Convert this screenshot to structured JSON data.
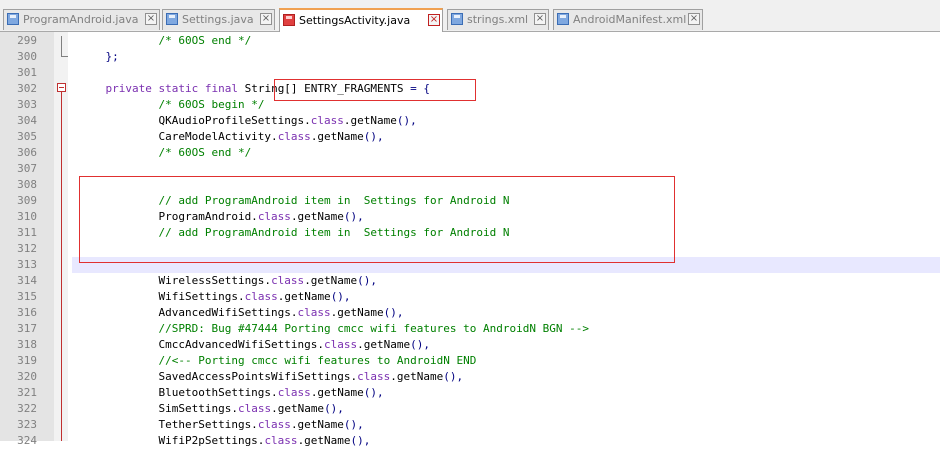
{
  "tabs": [
    {
      "label": "ProgramAndroid.java",
      "active": false
    },
    {
      "label": "Settings.java",
      "active": false
    },
    {
      "label": "SettingsActivity.java",
      "active": true
    },
    {
      "label": "strings.xml",
      "active": false
    },
    {
      "label": "AndroidManifest.xml",
      "active": false
    }
  ],
  "close_glyph": "×",
  "editor": {
    "lines": [
      {
        "n": "299",
        "tokens": [
          {
            "t": "            "
          },
          {
            "t": "/* 60OS end */",
            "c": "cm"
          }
        ]
      },
      {
        "n": "300",
        "tokens": [
          {
            "t": "    "
          },
          {
            "t": "};",
            "c": "op"
          }
        ]
      },
      {
        "n": "301",
        "tokens": []
      },
      {
        "n": "302",
        "tokens": [
          {
            "t": "    "
          },
          {
            "t": "private static final",
            "c": "kw"
          },
          {
            "t": " String[] ENTRY_FRAGMENTS "
          },
          {
            "t": "= {",
            "c": "op"
          }
        ]
      },
      {
        "n": "303",
        "tokens": [
          {
            "t": "            "
          },
          {
            "t": "/* 60OS begin */",
            "c": "cm"
          }
        ]
      },
      {
        "n": "304",
        "tokens": [
          {
            "t": "            QKAudioProfileSettings."
          },
          {
            "t": "class",
            "c": "kw"
          },
          {
            "t": ".getName"
          },
          {
            "t": "(),",
            "c": "op"
          }
        ]
      },
      {
        "n": "305",
        "tokens": [
          {
            "t": "            CareModelActivity."
          },
          {
            "t": "class",
            "c": "kw"
          },
          {
            "t": ".getName"
          },
          {
            "t": "(),",
            "c": "op"
          }
        ]
      },
      {
        "n": "306",
        "tokens": [
          {
            "t": "            "
          },
          {
            "t": "/* 60OS end */",
            "c": "cm"
          }
        ]
      },
      {
        "n": "307",
        "tokens": []
      },
      {
        "n": "308",
        "tokens": []
      },
      {
        "n": "309",
        "tokens": [
          {
            "t": "            "
          },
          {
            "t": "// add ProgramAndroid item in  Settings for Android N",
            "c": "cm"
          }
        ]
      },
      {
        "n": "310",
        "tokens": [
          {
            "t": "            ProgramAndroid."
          },
          {
            "t": "class",
            "c": "kw"
          },
          {
            "t": ".getName"
          },
          {
            "t": "(),",
            "c": "op"
          }
        ]
      },
      {
        "n": "311",
        "tokens": [
          {
            "t": "            "
          },
          {
            "t": "// add ProgramAndroid item in  Settings for Android N",
            "c": "cm"
          }
        ]
      },
      {
        "n": "312",
        "tokens": []
      },
      {
        "n": "313",
        "tokens": []
      },
      {
        "n": "314",
        "tokens": [
          {
            "t": "            WirelessSettings."
          },
          {
            "t": "class",
            "c": "kw"
          },
          {
            "t": ".getName"
          },
          {
            "t": "(),",
            "c": "op"
          }
        ]
      },
      {
        "n": "315",
        "tokens": [
          {
            "t": "            WifiSettings."
          },
          {
            "t": "class",
            "c": "kw"
          },
          {
            "t": ".getName"
          },
          {
            "t": "(),",
            "c": "op"
          }
        ]
      },
      {
        "n": "316",
        "tokens": [
          {
            "t": "            AdvancedWifiSettings."
          },
          {
            "t": "class",
            "c": "kw"
          },
          {
            "t": ".getName"
          },
          {
            "t": "(),",
            "c": "op"
          }
        ]
      },
      {
        "n": "317",
        "tokens": [
          {
            "t": "            "
          },
          {
            "t": "//SPRD: Bug #47444 Porting cmcc wifi features to AndroidN BGN -->",
            "c": "cm"
          }
        ]
      },
      {
        "n": "318",
        "tokens": [
          {
            "t": "            CmccAdvancedWifiSettings."
          },
          {
            "t": "class",
            "c": "kw"
          },
          {
            "t": ".getName"
          },
          {
            "t": "(),",
            "c": "op"
          }
        ]
      },
      {
        "n": "319",
        "tokens": [
          {
            "t": "            "
          },
          {
            "t": "//<-- Porting cmcc wifi features to AndroidN END",
            "c": "cm"
          }
        ]
      },
      {
        "n": "320",
        "tokens": [
          {
            "t": "            SavedAccessPointsWifiSettings."
          },
          {
            "t": "class",
            "c": "kw"
          },
          {
            "t": ".getName"
          },
          {
            "t": "(),",
            "c": "op"
          }
        ]
      },
      {
        "n": "321",
        "tokens": [
          {
            "t": "            BluetoothSettings."
          },
          {
            "t": "class",
            "c": "kw"
          },
          {
            "t": ".getName"
          },
          {
            "t": "(),",
            "c": "op"
          }
        ]
      },
      {
        "n": "322",
        "tokens": [
          {
            "t": "            SimSettings."
          },
          {
            "t": "class",
            "c": "kw"
          },
          {
            "t": ".getName"
          },
          {
            "t": "(),",
            "c": "op"
          }
        ]
      },
      {
        "n": "323",
        "tokens": [
          {
            "t": "            TetherSettings."
          },
          {
            "t": "class",
            "c": "kw"
          },
          {
            "t": ".getName"
          },
          {
            "t": "(),",
            "c": "op"
          }
        ]
      },
      {
        "n": "324",
        "tokens": [
          {
            "t": "            WifiP2pSettings."
          },
          {
            "t": "class",
            "c": "kw"
          },
          {
            "t": ".getName"
          },
          {
            "t": "(),",
            "c": "op"
          }
        ]
      }
    ]
  },
  "colors": {
    "keyword": "#7a2fb0",
    "comment": "#008000",
    "operator": "#000080",
    "annotation_box": "#e03030",
    "line_numbers": "#808080",
    "active_tab_accent": "#f0a050"
  },
  "icons": {
    "file": "file-save-icon",
    "close": "close-icon",
    "fold": "fold-collapse-icon"
  }
}
